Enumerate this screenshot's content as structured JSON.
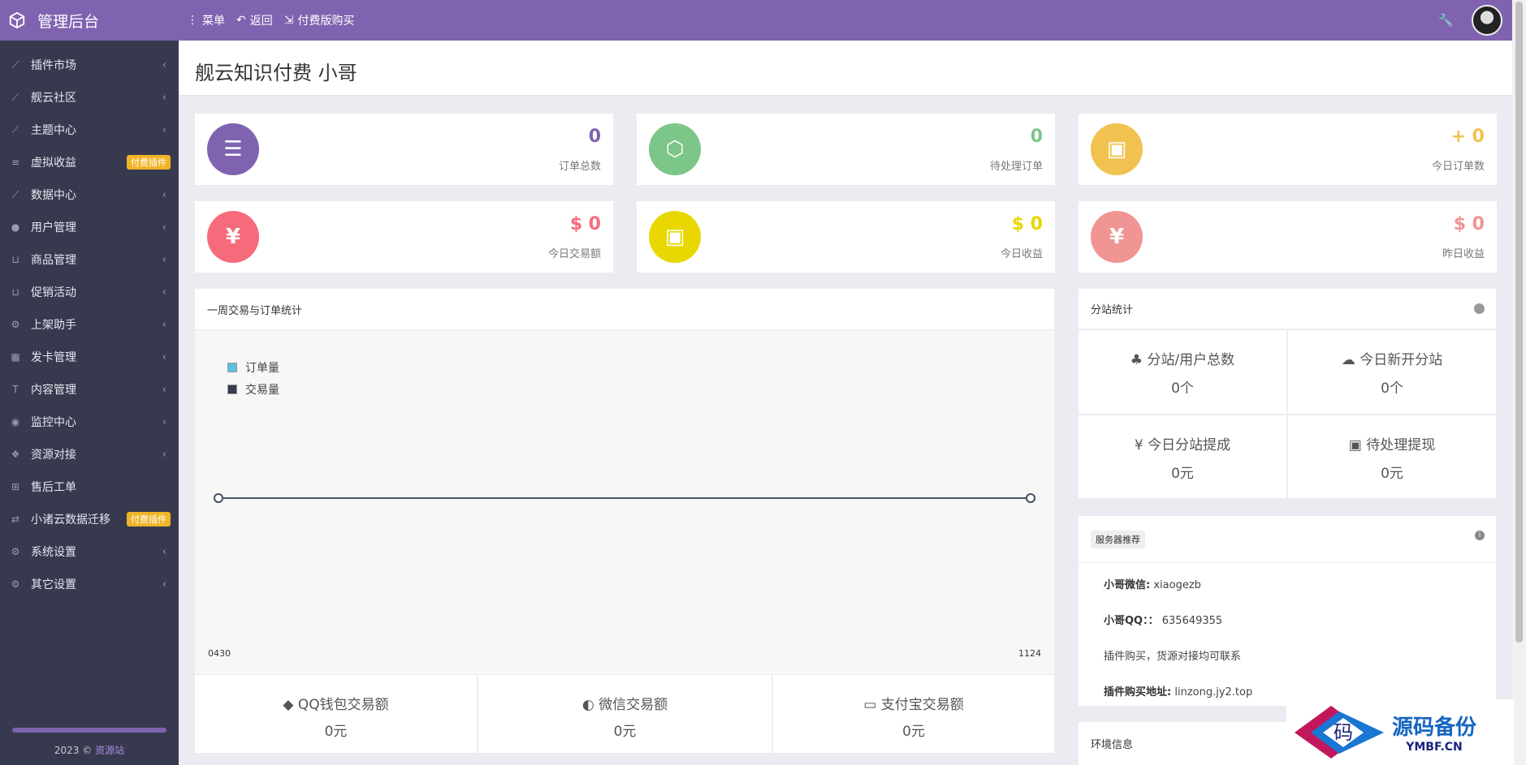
{
  "topbar": {
    "brand": "管理后台",
    "links": [
      {
        "icon": "more-vertical-icon",
        "label": "菜单"
      },
      {
        "icon": "undo-icon",
        "label": "返回"
      },
      {
        "icon": "sign-out-icon",
        "label": "付费版购买"
      }
    ]
  },
  "sidebar": {
    "items": [
      {
        "label": "插件市场",
        "icon": "chart-line-icon"
      },
      {
        "label": "舰云社区",
        "icon": "chart-line-icon"
      },
      {
        "label": "主题中心",
        "icon": "chart-line-icon"
      },
      {
        "label": "虚拟收益",
        "icon": "list-icon",
        "badge": "付费插件"
      },
      {
        "label": "数据中心",
        "icon": "chart-line-icon"
      },
      {
        "label": "用户管理",
        "icon": "user-icon"
      },
      {
        "label": "商品管理",
        "icon": "cart-icon"
      },
      {
        "label": "促销活动",
        "icon": "cart-icon"
      },
      {
        "label": "上架助手",
        "icon": "cogs-icon"
      },
      {
        "label": "发卡管理",
        "icon": "grid-icon"
      },
      {
        "label": "内容管理",
        "icon": "text-icon"
      },
      {
        "label": "监控中心",
        "icon": "circle-dot-icon"
      },
      {
        "label": "资源对接",
        "icon": "cubes-icon"
      },
      {
        "label": "售后工单",
        "icon": "plus-square-icon"
      },
      {
        "label": "小诸云数据迁移",
        "icon": "exchange-icon",
        "badge": "付费插件"
      },
      {
        "label": "系统设置",
        "icon": "gear-icon"
      },
      {
        "label": "其它设置",
        "icon": "cogs-icon"
      }
    ],
    "footer_year": "2023 ©",
    "footer_link": "资源站"
  },
  "page": {
    "title": "舰云知识付费 小哥"
  },
  "stats": [
    {
      "value": "0",
      "label": "订单总数",
      "color": "#7f63b0",
      "value_color": "#7f63b0",
      "glyph": "☰"
    },
    {
      "value": "0",
      "label": "待处理订单",
      "color": "#7cc68a",
      "value_color": "#7cc68a",
      "glyph": "⬡"
    },
    {
      "value": "+ 0",
      "label": "今日订单数",
      "color": "#f1c24f",
      "value_color": "#f1c24f",
      "glyph": "▣"
    },
    {
      "value": "$ 0",
      "label": "今日交易额",
      "color": "#f66b7c",
      "value_color": "#f66b7c",
      "glyph": "¥"
    },
    {
      "value": "$ 0",
      "label": "今日收益",
      "color": "#e8d800",
      "value_color": "#e8d800",
      "glyph": "▣"
    },
    {
      "value": "$ 0",
      "label": "昨日收益",
      "color": "#f09494",
      "value_color": "#f09494",
      "glyph": "¥"
    }
  ],
  "weekly": {
    "title": "一周交易与订单统计",
    "legend": [
      {
        "name": "订单量",
        "color": "#5bc0de"
      },
      {
        "name": "交易量",
        "color": "#373a4f"
      }
    ],
    "x_start": "0430",
    "x_end": "1124"
  },
  "chart_data": {
    "type": "line",
    "x": [
      "0430",
      "1124"
    ],
    "series": [
      {
        "name": "订单量",
        "values": [
          0,
          0
        ]
      },
      {
        "name": "交易量",
        "values": [
          0,
          0
        ]
      }
    ]
  },
  "payments": [
    {
      "icon": "qq-icon",
      "title": "QQ钱包交易额",
      "value": "0元"
    },
    {
      "icon": "wechat-icon",
      "title": "微信交易额",
      "value": "0元"
    },
    {
      "icon": "credit-card-icon",
      "title": "支付宝交易额",
      "value": "0元"
    }
  ],
  "substation": {
    "title": "分站统计",
    "cells": [
      {
        "icon": "sitemap-icon",
        "title": "分站/用户总数",
        "value": "0个"
      },
      {
        "icon": "cloud-icon",
        "title": "今日新开分站",
        "value": "0个"
      },
      {
        "icon": "yen-icon",
        "title": "今日分站提成",
        "value": "0元"
      },
      {
        "icon": "money-icon",
        "title": "待处理提现",
        "value": "0元"
      }
    ]
  },
  "server": {
    "tag": "服务器推荐",
    "lines": [
      {
        "label": "小哥微信",
        "sep": ":",
        "value": "xiaogezb"
      },
      {
        "label": "小哥QQ",
        "sep": "：：",
        "value": "635649355"
      },
      {
        "label": "",
        "sep": "",
        "value": "插件购买，货源对接均可联系"
      },
      {
        "label": "插件购买地址",
        "sep": ":",
        "value": "linzong.jy2.top"
      }
    ]
  },
  "env": {
    "title": "环境信息"
  },
  "watermark": {
    "main": "源码备份",
    "sub": "YMBF.CN",
    "mark": "码"
  }
}
